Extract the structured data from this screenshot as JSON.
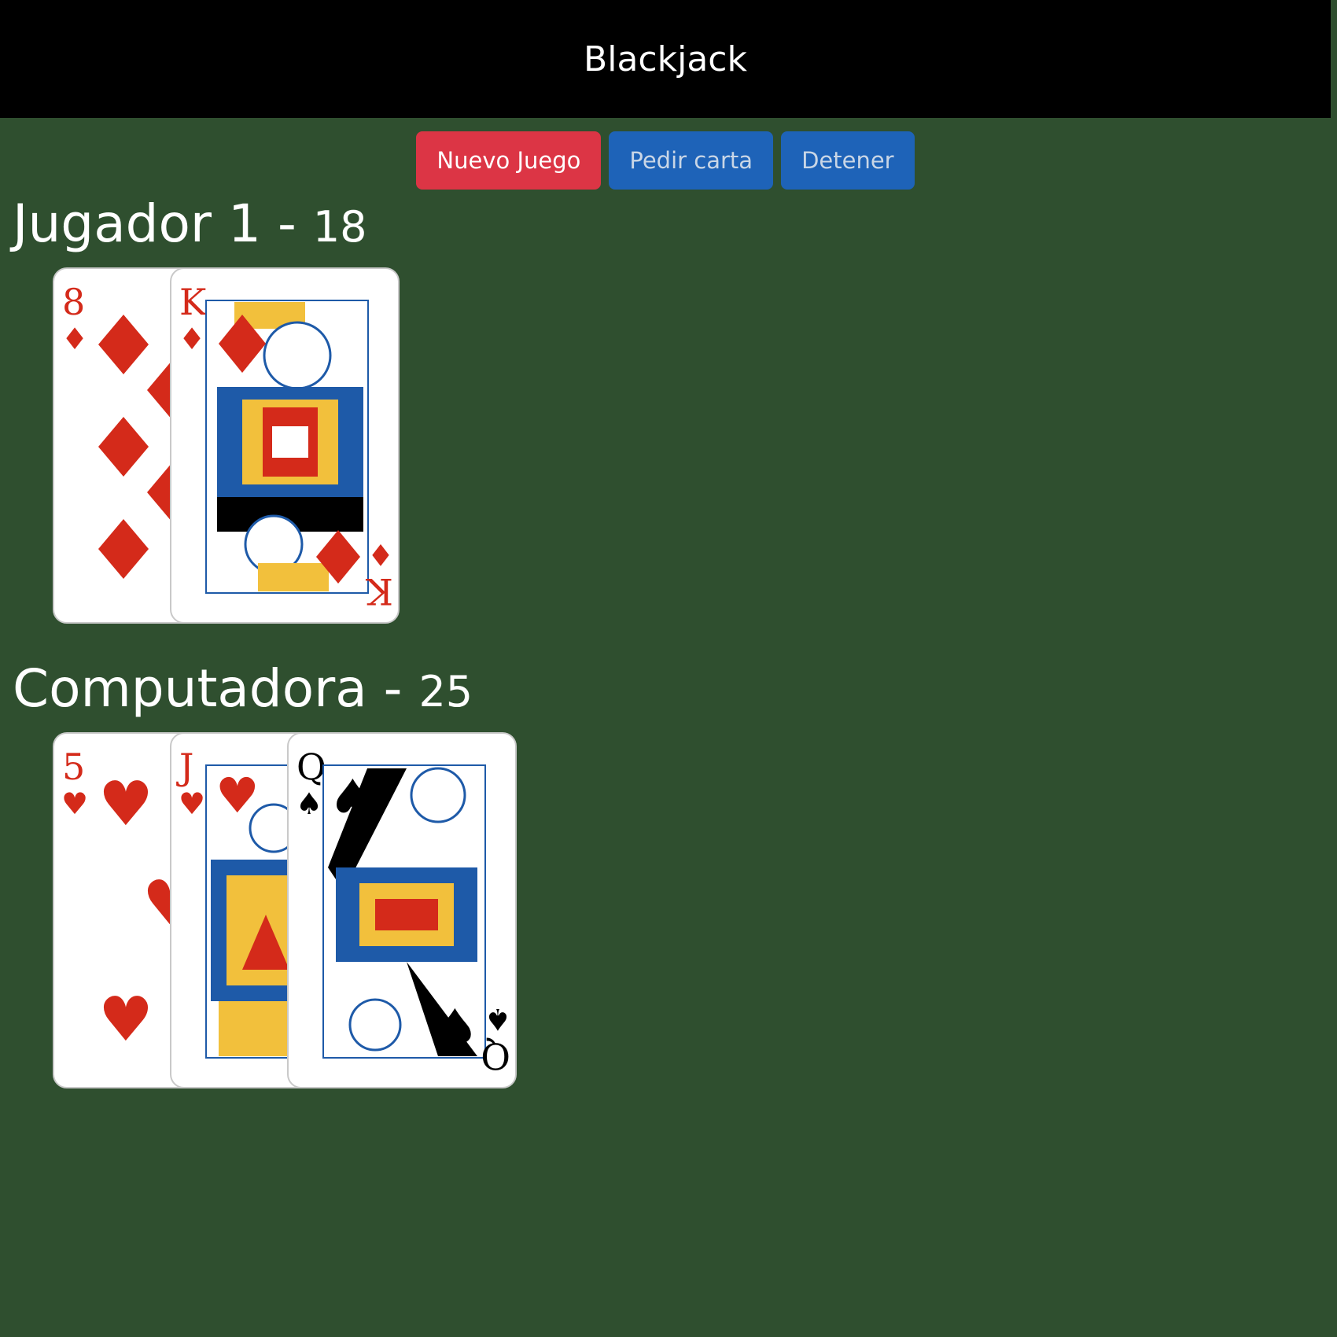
{
  "header": {
    "title": "Blackjack"
  },
  "controls": {
    "new_game": "Nuevo Juego",
    "hit": "Pedir carta",
    "stand": "Detener"
  },
  "players": [
    {
      "name": "Jugador 1",
      "separator": "-",
      "score": "18",
      "cards": [
        {
          "rank": "8",
          "suit": "♦",
          "color": "#d42a1a"
        },
        {
          "rank": "K",
          "suit": "♦",
          "color": "#d42a1a"
        }
      ]
    },
    {
      "name": "Computadora",
      "separator": "-",
      "score": "25",
      "cards": [
        {
          "rank": "5",
          "suit": "♥",
          "color": "#d42a1a"
        },
        {
          "rank": "J",
          "suit": "♥",
          "color": "#d42a1a"
        },
        {
          "rank": "Q",
          "suit": "♠",
          "color": "#000000"
        }
      ]
    }
  ]
}
